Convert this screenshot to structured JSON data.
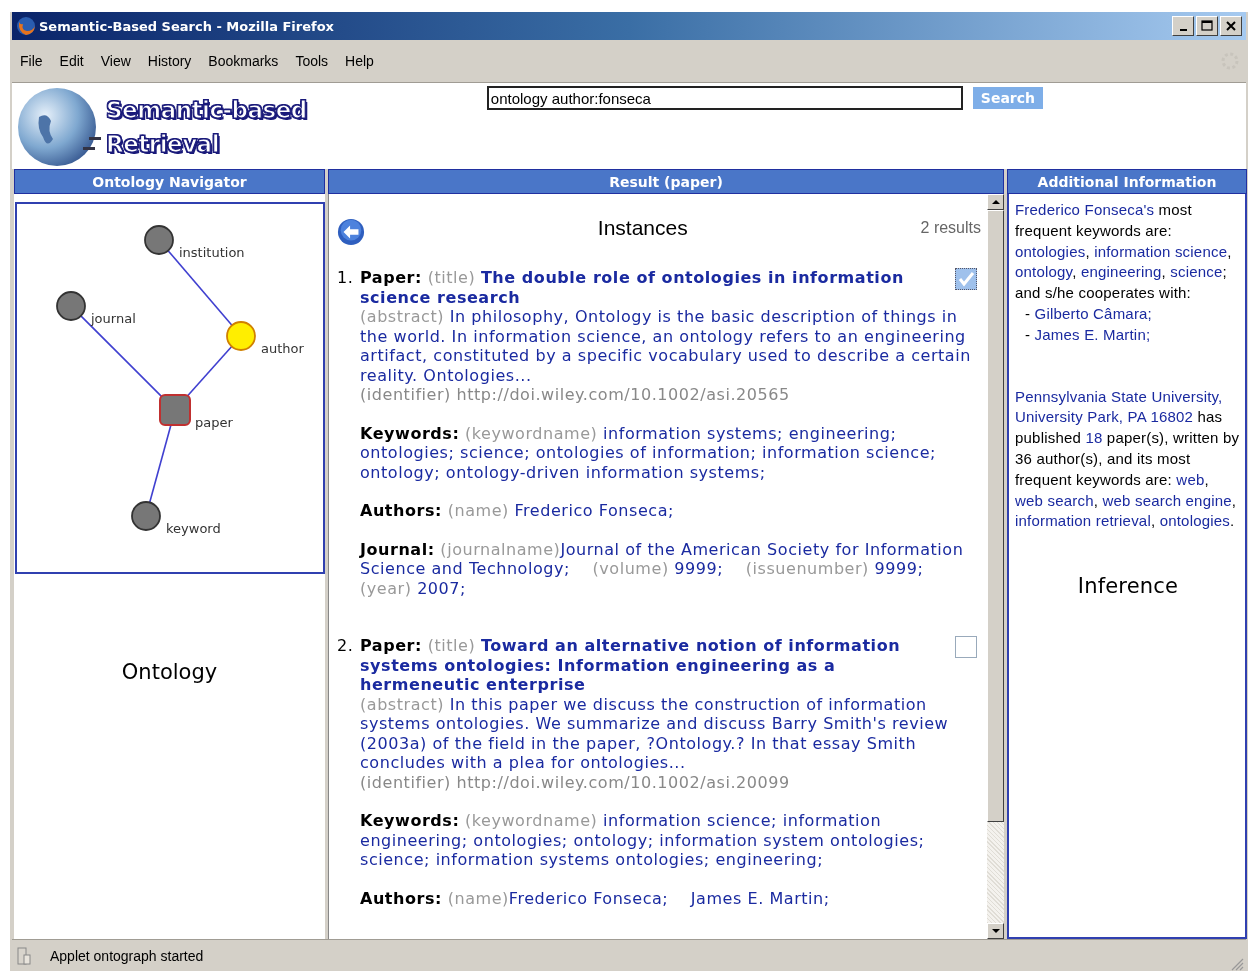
{
  "window": {
    "title": "Semantic-Based Search - Mozilla Firefox"
  },
  "menu": [
    {
      "label": "File"
    },
    {
      "label": "Edit"
    },
    {
      "label": "View"
    },
    {
      "label": "History"
    },
    {
      "label": "Bookmarks"
    },
    {
      "label": "Tools"
    },
    {
      "label": "Help"
    }
  ],
  "header": {
    "logo_lines": [
      "Semantic-based",
      "Retrieval"
    ],
    "search": {
      "value": "ontology author:fonseca"
    },
    "search_button": "Search"
  },
  "ontology_panel": {
    "title": "Ontology Navigator",
    "caption": "Ontology",
    "graph": {
      "root": {
        "label": "paper",
        "kind": "square",
        "color": "#777777",
        "children": [
          {
            "label": "journal",
            "kind": "circle",
            "color": "#777777"
          },
          {
            "label": "author",
            "kind": "circle",
            "color": "#ffee00",
            "children": [
              {
                "label": "institution",
                "kind": "circle",
                "color": "#777777"
              }
            ]
          },
          {
            "label": "keyword",
            "kind": "circle",
            "color": "#777777"
          }
        ]
      }
    }
  },
  "result_panel": {
    "title": "Result (paper)",
    "heading": "Instances",
    "count": "2 results",
    "results": [
      {
        "number": "1.",
        "checked": true,
        "label": "Paper:",
        "title_hint": "(title)",
        "title": "The double role of ontologies in information science research",
        "abstract_hint": "(abstract)",
        "abstract": "In philosophy, Ontology is the basic description of things in the world. In information science, an ontology refers to an engineering artifact, constituted by a specific vocabulary used to describe a certain reality. Ontologies...",
        "identifier_hint": "(identifier)",
        "identifier": "http://doi.wiley.com/10.1002/asi.20565",
        "sections": [
          {
            "label": "Keywords:",
            "parts": [
              {
                "hint": "(keywordname)",
                "value": "information systems; engineering; ontologies; science; ontologies of information; information science; ontology; ontology-driven information systems;"
              }
            ]
          },
          {
            "label": "Authors:",
            "parts": [
              {
                "hint": "(name)",
                "value": "Frederico Fonseca;"
              }
            ]
          },
          {
            "label": "Journal:",
            "parts": [
              {
                "hint": "(journalname)",
                "value": "Journal of the American Society for Information Science and Technology;"
              },
              {
                "hint": "(volume)",
                "value": "9999;"
              },
              {
                "hint": "(issuenumber)",
                "value": "9999;"
              },
              {
                "hint": "(year)",
                "value": "2007;"
              }
            ]
          }
        ]
      },
      {
        "number": "2.",
        "checked": false,
        "label": "Paper:",
        "title_hint": "(title)",
        "title": "Toward an alternative notion of information systems ontologies: Information engineering as a hermeneutic enterprise",
        "abstract_hint": "(abstract)",
        "abstract": "In this paper we discuss the construction of information systems ontologies. We summarize and discuss Barry Smith's review (2003a) of the field in the paper, ?Ontology.? In that essay Smith concludes with a plea for ontologies...",
        "identifier_hint": "(identifier)",
        "identifier": "http://doi.wiley.com/10.1002/asi.20099",
        "sections": [
          {
            "label": "Keywords:",
            "parts": [
              {
                "hint": "(keywordname)",
                "value": "information science; information engineering; ontologies; ontology; information system ontologies; science; information systems ontologies; engineering;"
              }
            ]
          },
          {
            "label": "Authors:",
            "parts": [
              {
                "hint": "(name)",
                "value": "Frederico Fonseca;"
              },
              {
                "value": "James E. Martin;"
              }
            ]
          }
        ]
      }
    ]
  },
  "info_panel": {
    "title": "Additional Information",
    "caption": "Inference",
    "blocks": [
      {
        "kind": "paragraph",
        "segments": [
          {
            "text": "Frederico Fonseca's",
            "linked": true
          },
          {
            "text": " most frequent keywords are: ",
            "linked": false
          },
          {
            "text": "ontologies",
            "linked": true
          },
          {
            "text": ", ",
            "linked": false
          },
          {
            "text": "information science",
            "linked": true
          },
          {
            "text": ", ",
            "linked": false
          },
          {
            "text": "ontology",
            "linked": true
          },
          {
            "text": ", ",
            "linked": false
          },
          {
            "text": "engineering",
            "linked": true
          },
          {
            "text": ", ",
            "linked": false
          },
          {
            "text": "science",
            "linked": true
          },
          {
            "text": "; and s/he cooperates with:",
            "linked": false
          }
        ]
      },
      {
        "kind": "list_item",
        "segments": [
          {
            "text": "- ",
            "linked": false
          },
          {
            "text": "Gilberto Câmara;",
            "linked": true
          }
        ]
      },
      {
        "kind": "list_item",
        "segments": [
          {
            "text": "- ",
            "linked": false
          },
          {
            "text": "James E. Martin;",
            "linked": true
          }
        ]
      },
      {
        "kind": "paragraph",
        "segments": [
          {
            "text": "Pennsylvania State University, University Park, PA 16802",
            "linked": true
          },
          {
            "text": " has published ",
            "linked": false
          },
          {
            "text": "18",
            "linked": true
          },
          {
            "text": " paper(s), written by 36 author(s), and its most frequent keywords are: ",
            "linked": false
          },
          {
            "text": "web",
            "linked": true
          },
          {
            "text": ", ",
            "linked": false
          },
          {
            "text": "web search",
            "linked": true
          },
          {
            "text": ", ",
            "linked": false
          },
          {
            "text": "web search engine",
            "linked": true
          },
          {
            "text": ", ",
            "linked": false
          },
          {
            "text": "information retrieval",
            "linked": true
          },
          {
            "text": ", ",
            "linked": false
          },
          {
            "text": "ontologies",
            "linked": true
          },
          {
            "text": ".",
            "linked": false
          }
        ]
      }
    ]
  },
  "status_bar": {
    "text": "Applet ontograph started"
  }
}
